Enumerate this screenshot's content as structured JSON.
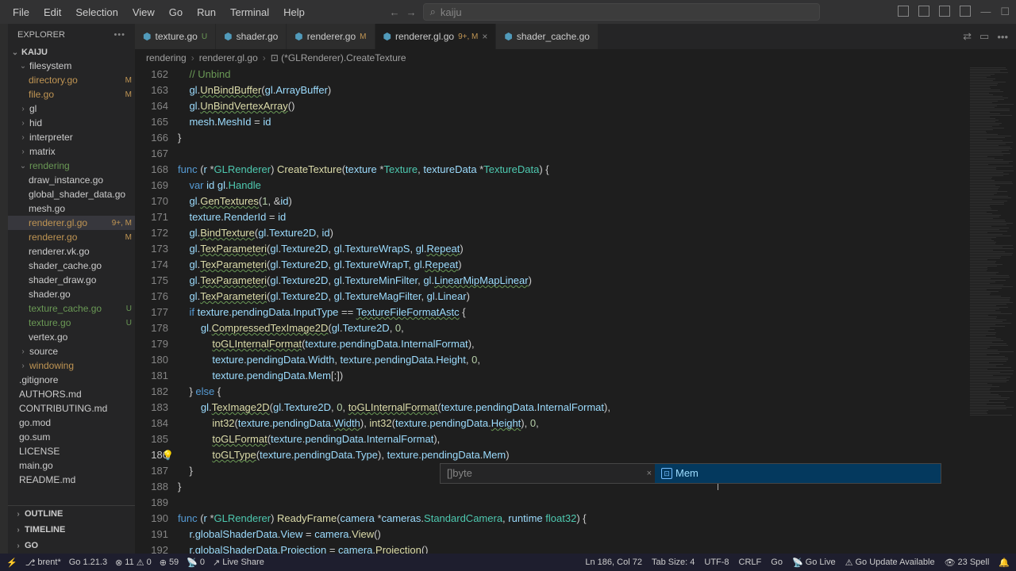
{
  "menu": [
    "File",
    "Edit",
    "Selection",
    "View",
    "Go",
    "Run",
    "Terminal",
    "Help"
  ],
  "search_placeholder": "kaiju",
  "sidebar": {
    "title": "EXPLORER",
    "project": "KAIJU",
    "tree": [
      {
        "type": "folder",
        "label": "filesystem",
        "indent": 1,
        "open": true
      },
      {
        "type": "file",
        "label": "directory.go",
        "indent": 2,
        "status": "M",
        "modified": true
      },
      {
        "type": "file",
        "label": "file.go",
        "indent": 2,
        "status": "M",
        "modified": true
      },
      {
        "type": "folder",
        "label": "gl",
        "indent": 1,
        "closed": true
      },
      {
        "type": "folder",
        "label": "hid",
        "indent": 1,
        "closed": true
      },
      {
        "type": "folder",
        "label": "interpreter",
        "indent": 1,
        "closed": true
      },
      {
        "type": "folder",
        "label": "matrix",
        "indent": 1,
        "closed": true
      },
      {
        "type": "folder",
        "label": "rendering",
        "indent": 1,
        "open": true,
        "untracked": true
      },
      {
        "type": "file",
        "label": "draw_instance.go",
        "indent": 2
      },
      {
        "type": "file",
        "label": "global_shader_data.go",
        "indent": 2
      },
      {
        "type": "file",
        "label": "mesh.go",
        "indent": 2
      },
      {
        "type": "file",
        "label": "renderer.gl.go",
        "indent": 2,
        "status": "9+, M",
        "modified": true,
        "active": true
      },
      {
        "type": "file",
        "label": "renderer.go",
        "indent": 2,
        "status": "M",
        "modified": true
      },
      {
        "type": "file",
        "label": "renderer.vk.go",
        "indent": 2
      },
      {
        "type": "file",
        "label": "shader_cache.go",
        "indent": 2
      },
      {
        "type": "file",
        "label": "shader_draw.go",
        "indent": 2
      },
      {
        "type": "file",
        "label": "shader.go",
        "indent": 2
      },
      {
        "type": "file",
        "label": "texture_cache.go",
        "indent": 2,
        "status": "U",
        "untracked": true
      },
      {
        "type": "file",
        "label": "texture.go",
        "indent": 2,
        "status": "U",
        "untracked": true
      },
      {
        "type": "file",
        "label": "vertex.go",
        "indent": 2
      },
      {
        "type": "folder",
        "label": "source",
        "indent": 1,
        "closed": true
      },
      {
        "type": "folder",
        "label": "windowing",
        "indent": 1,
        "closed": true,
        "modified": true
      },
      {
        "type": "file",
        "label": ".gitignore",
        "indent": 1
      },
      {
        "type": "file",
        "label": "AUTHORS.md",
        "indent": 1
      },
      {
        "type": "file",
        "label": "CONTRIBUTING.md",
        "indent": 1
      },
      {
        "type": "file",
        "label": "go.mod",
        "indent": 1
      },
      {
        "type": "file",
        "label": "go.sum",
        "indent": 1
      },
      {
        "type": "file",
        "label": "LICENSE",
        "indent": 1
      },
      {
        "type": "file",
        "label": "main.go",
        "indent": 1
      },
      {
        "type": "file",
        "label": "README.md",
        "indent": 1
      }
    ],
    "bottom": [
      "OUTLINE",
      "TIMELINE",
      "GO"
    ]
  },
  "tabs": [
    {
      "label": "texture.go",
      "status": "U",
      "untracked": true
    },
    {
      "label": "shader.go"
    },
    {
      "label": "renderer.go",
      "status": "M",
      "modified": true
    },
    {
      "label": "renderer.gl.go",
      "status": "9+, M",
      "modified": true,
      "active": true,
      "close": true
    },
    {
      "label": "shader_cache.go"
    }
  ],
  "breadcrumb": [
    "rendering",
    "renderer.gl.go",
    "(*GLRenderer).CreateTexture"
  ],
  "code_start_line": 162,
  "autocomplete": {
    "hint": "[]byte",
    "item": "Mem"
  },
  "statusbar": {
    "branch": "brent*",
    "go_version": "Go 1.21.3",
    "errors": "11",
    "warnings": "0",
    "port": "59",
    "radio": "0",
    "live_share": "Live Share",
    "position": "Ln 186, Col 72",
    "tab_size": "Tab Size: 4",
    "encoding": "UTF-8",
    "eol": "CRLF",
    "lang": "Go",
    "go_live": "Go Live",
    "update": "Go Update Available",
    "spell": "23 Spell"
  }
}
